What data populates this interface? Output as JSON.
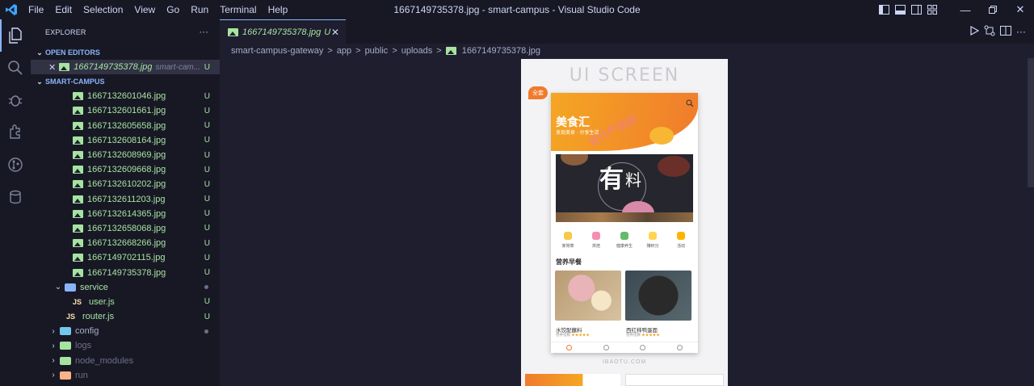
{
  "window": {
    "title": "1667149735378.jpg - smart-campus - Visual Studio Code",
    "menu": [
      "File",
      "Edit",
      "Selection",
      "View",
      "Go",
      "Run",
      "Terminal",
      "Help"
    ]
  },
  "activity_bar": [
    "explorer-icon",
    "search-icon",
    "debug-icon",
    "extensions-icon",
    "source-control-icon",
    "database-icon"
  ],
  "sidebar": {
    "header": "EXPLORER",
    "more": "···",
    "open_editors_label": "OPEN EDITORS",
    "open_editor": {
      "name": "1667149735378.jpg",
      "desc": "smart-cam...",
      "badge": "U"
    },
    "project_label": "SMART-CAMPUS",
    "files": [
      {
        "name": "1667132601046.jpg",
        "badge": "U"
      },
      {
        "name": "1667132601661.jpg",
        "badge": "U"
      },
      {
        "name": "1667132605658.jpg",
        "badge": "U"
      },
      {
        "name": "1667132608164.jpg",
        "badge": "U"
      },
      {
        "name": "1667132608969.jpg",
        "badge": "U"
      },
      {
        "name": "1667132609668.jpg",
        "badge": "U"
      },
      {
        "name": "1667132610202.jpg",
        "badge": "U"
      },
      {
        "name": "1667132611203.jpg",
        "badge": "U"
      },
      {
        "name": "1667132614365.jpg",
        "badge": "U"
      },
      {
        "name": "1667132658068.jpg",
        "badge": "U"
      },
      {
        "name": "1667132668266.jpg",
        "badge": "U"
      },
      {
        "name": "1667149702115.jpg",
        "badge": "U"
      },
      {
        "name": "1667149735378.jpg",
        "badge": "U"
      }
    ],
    "service_folder": "service",
    "user_js": {
      "name": "user.js",
      "badge": "U"
    },
    "router_js": {
      "name": "router.js",
      "badge": "U"
    },
    "config_folder": "config",
    "logs_folder": "logs",
    "node_modules_folder": "node_modules",
    "run_folder": "run",
    "js_label": "JS"
  },
  "editor": {
    "tab_label": "1667149735378.jpg",
    "tab_badge": "U",
    "breadcrumb": [
      "smart-campus-gateway",
      "app",
      "public",
      "uploads",
      "1667149735378.jpg"
    ],
    "sep": ">"
  },
  "preview": {
    "heading": "UI SCREEN",
    "tag": "全套",
    "app_title": "美食汇",
    "app_subtitle": "发现美食 · 分享生活",
    "banner_char1": "有",
    "banner_char2": "料",
    "categories": [
      "家常菜",
      "烘焙",
      "健康养生",
      "赚积分",
      "活动"
    ],
    "section": "营养早餐",
    "foods": [
      {
        "name": "水饺配蘸料",
        "meta": "营养指数",
        "stars": "★★★★★"
      },
      {
        "name": "西红柿鸭蛋面",
        "meta": "营养指数",
        "stars": "★★★★★"
      }
    ],
    "watermark": "设计产品站",
    "footer": "IBAOTU.COM"
  }
}
